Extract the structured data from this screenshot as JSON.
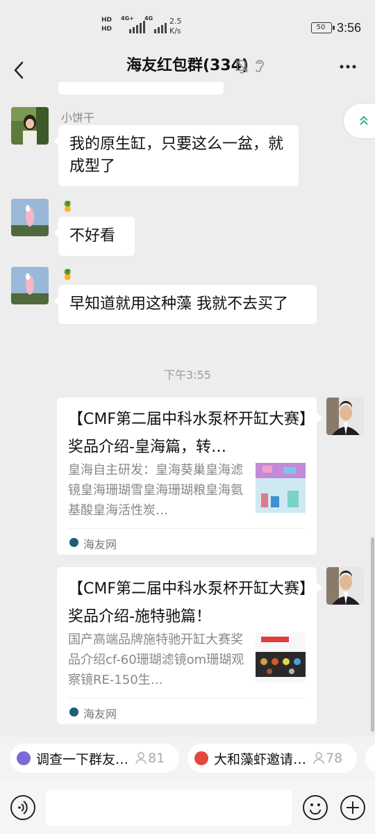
{
  "status_bar": {
    "sim1": "HD",
    "sim2": "HD",
    "net1": "4G+",
    "net2": "4G",
    "speed_value": "2.5",
    "speed_unit": "K/s",
    "battery": "50",
    "time": "3:56"
  },
  "header": {
    "title": "海友红包群(334)",
    "icons": [
      "back-icon",
      "mute-icon",
      "ear-icon",
      "more-icon"
    ]
  },
  "messages": [
    {
      "nickname": "小饼干",
      "text": "我的原生缸，只要这么一盆，就成型了"
    },
    {
      "nickname": "🍍",
      "text": "不好看"
    },
    {
      "nickname": "🍍",
      "text": "早知道就用这种藻 我就不去买了"
    }
  ],
  "timestamp": "下午3:55",
  "cards": [
    {
      "title": "【CMF第二届中科水泵杯开缸大赛】奖品介绍-皇海篇，转…",
      "desc": "皇海自主研发：皇海葵巢皇海滤镜皇海珊瑚雪皇海珊瑚粮皇海氨基酸皇海活性炭…",
      "source": "海友网"
    },
    {
      "title": "【CMF第二届中科水泵杯开缸大赛】奖品介绍-施特驰篇！",
      "desc": "国产高端品牌施特驰开缸大赛奖品介绍cf-60珊瑚滤镜om珊瑚观察镜RE-150生…",
      "source": "海友网"
    }
  ],
  "chips": [
    {
      "label": "调查一下群友…",
      "count": "81",
      "color": "#7c6bd6"
    },
    {
      "label": "大和藻虾邀请…",
      "count": "78",
      "color": "#e1483a"
    }
  ],
  "colors": {
    "background": "#ededed",
    "bubble": "#ffffff",
    "source_icon": "#1c5e72"
  }
}
